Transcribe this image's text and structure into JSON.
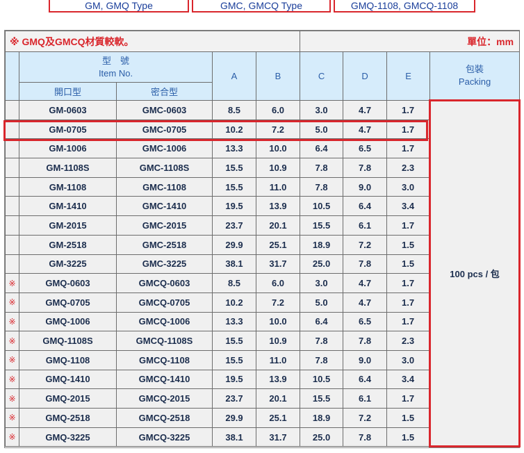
{
  "tabs": [
    "GM, GMQ Type",
    "GMC, GMCQ Type",
    "GMQ-1108, GMCQ-1108"
  ],
  "title": {
    "left": "※ GMQ及GMCQ材質較軟。",
    "right": "單位：mm"
  },
  "headers": {
    "item_cn": "型　號",
    "item_en": "Item No.",
    "open_type": "開口型",
    "closed_type": "密合型",
    "A": "A",
    "B": "B",
    "C": "C",
    "D": "D",
    "E": "E",
    "packing_cn": "包裝",
    "packing_en": "Packing"
  },
  "packing_value": "100 pcs / 包",
  "rows": [
    {
      "mark": "",
      "open": "GM-0603",
      "closed": "GMC-0603",
      "A": "8.5",
      "B": "6.0",
      "C": "3.0",
      "D": "4.7",
      "E": "1.7"
    },
    {
      "mark": "",
      "open": "GM-0705",
      "closed": "GMC-0705",
      "A": "10.2",
      "B": "7.2",
      "C": "5.0",
      "D": "4.7",
      "E": "1.7"
    },
    {
      "mark": "",
      "open": "GM-1006",
      "closed": "GMC-1006",
      "A": "13.3",
      "B": "10.0",
      "C": "6.4",
      "D": "6.5",
      "E": "1.7"
    },
    {
      "mark": "",
      "open": "GM-1108S",
      "closed": "GMC-1108S",
      "A": "15.5",
      "B": "10.9",
      "C": "7.8",
      "D": "7.8",
      "E": "2.3"
    },
    {
      "mark": "",
      "open": "GM-1108",
      "closed": "GMC-1108",
      "A": "15.5",
      "B": "11.0",
      "C": "7.8",
      "D": "9.0",
      "E": "3.0"
    },
    {
      "mark": "",
      "open": "GM-1410",
      "closed": "GMC-1410",
      "A": "19.5",
      "B": "13.9",
      "C": "10.5",
      "D": "6.4",
      "E": "3.4"
    },
    {
      "mark": "",
      "open": "GM-2015",
      "closed": "GMC-2015",
      "A": "23.7",
      "B": "20.1",
      "C": "15.5",
      "D": "6.1",
      "E": "1.7"
    },
    {
      "mark": "",
      "open": "GM-2518",
      "closed": "GMC-2518",
      "A": "29.9",
      "B": "25.1",
      "C": "18.9",
      "D": "7.2",
      "E": "1.5"
    },
    {
      "mark": "",
      "open": "GM-3225",
      "closed": "GMC-3225",
      "A": "38.1",
      "B": "31.7",
      "C": "25.0",
      "D": "7.8",
      "E": "1.5"
    },
    {
      "mark": "※",
      "open": "GMQ-0603",
      "closed": "GMCQ-0603",
      "A": "8.5",
      "B": "6.0",
      "C": "3.0",
      "D": "4.7",
      "E": "1.7"
    },
    {
      "mark": "※",
      "open": "GMQ-0705",
      "closed": "GMCQ-0705",
      "A": "10.2",
      "B": "7.2",
      "C": "5.0",
      "D": "4.7",
      "E": "1.7"
    },
    {
      "mark": "※",
      "open": "GMQ-1006",
      "closed": "GMCQ-1006",
      "A": "13.3",
      "B": "10.0",
      "C": "6.4",
      "D": "6.5",
      "E": "1.7"
    },
    {
      "mark": "※",
      "open": "GMQ-1108S",
      "closed": "GMCQ-1108S",
      "A": "15.5",
      "B": "10.9",
      "C": "7.8",
      "D": "7.8",
      "E": "2.3"
    },
    {
      "mark": "※",
      "open": "GMQ-1108",
      "closed": "GMCQ-1108",
      "A": "15.5",
      "B": "11.0",
      "C": "7.8",
      "D": "9.0",
      "E": "3.0"
    },
    {
      "mark": "※",
      "open": "GMQ-1410",
      "closed": "GMCQ-1410",
      "A": "19.5",
      "B": "13.9",
      "C": "10.5",
      "D": "6.4",
      "E": "3.4"
    },
    {
      "mark": "※",
      "open": "GMQ-2015",
      "closed": "GMCQ-2015",
      "A": "23.7",
      "B": "20.1",
      "C": "15.5",
      "D": "6.1",
      "E": "1.7"
    },
    {
      "mark": "※",
      "open": "GMQ-2518",
      "closed": "GMCQ-2518",
      "A": "29.9",
      "B": "25.1",
      "C": "18.9",
      "D": "7.2",
      "E": "1.5"
    },
    {
      "mark": "※",
      "open": "GMQ-3225",
      "closed": "GMCQ-3225",
      "A": "38.1",
      "B": "31.7",
      "C": "25.0",
      "D": "7.8",
      "E": "1.5"
    }
  ],
  "colors": {
    "accent_red": "#d9262c",
    "header_bg": "#d6ecfb",
    "header_text": "#2b5ea8",
    "row_bg": "#f0f0f0"
  }
}
